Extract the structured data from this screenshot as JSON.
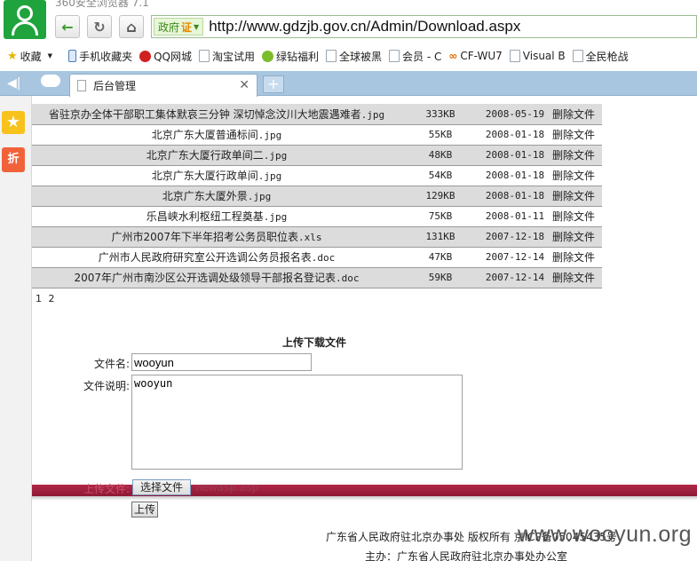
{
  "browser": {
    "title_text": "360安全浏览器 7.1",
    "gov_badge": "政府",
    "cert_badge": "证",
    "url": "http://www.gdzjb.gov.cn/Admin/Download.aspx",
    "tab_label": "后台管理",
    "bookmarks": [
      "收藏",
      "手机收藏夹",
      "QQ网城",
      "淘宝试用",
      "绿钻福利",
      "全球被黑",
      "会员 - C",
      "CF-WU7",
      "Visual B",
      "全民枪战"
    ]
  },
  "files": [
    {
      "name": "省驻京办全体干部职工集体默哀三分钟 深切悼念汶川大地震遇难者",
      "ext": ".jpg",
      "size": "333KB",
      "date": "2008-05-19",
      "action": "删除文件"
    },
    {
      "name": "北京广东大厦普通标间",
      "ext": ".jpg",
      "size": "55KB",
      "date": "2008-01-18",
      "action": "删除文件"
    },
    {
      "name": "北京广东大厦行政单间二",
      "ext": ".jpg",
      "size": "48KB",
      "date": "2008-01-18",
      "action": "删除文件"
    },
    {
      "name": "北京广东大厦行政单间",
      "ext": ".jpg",
      "size": "54KB",
      "date": "2008-01-18",
      "action": "删除文件"
    },
    {
      "name": "北京广东大厦外景",
      "ext": ".jpg",
      "size": "129KB",
      "date": "2008-01-18",
      "action": "删除文件"
    },
    {
      "name": "乐昌峡水利枢纽工程奠基",
      "ext": ".jpg",
      "size": "75KB",
      "date": "2008-01-11",
      "action": "删除文件"
    },
    {
      "name": "广州市2007年下半年招考公务员职位表",
      "ext": ".xls",
      "size": "131KB",
      "date": "2007-12-18",
      "action": "删除文件"
    },
    {
      "name": "广州市人民政府研究室公开选调公务员报名表",
      "ext": ".doc",
      "size": "47KB",
      "date": "2007-12-14",
      "action": "删除文件"
    },
    {
      "name": "2007年广州市南沙区公开选调处级领导干部报名登记表",
      "ext": ".doc",
      "size": "59KB",
      "date": "2007-12-14",
      "action": "删除文件"
    }
  ],
  "pager": "1 2",
  "upload": {
    "title": "上传下载文件",
    "name_label": "文件名:",
    "name_value": "wooyun",
    "desc_label": "文件说明:",
    "desc_value": "wooyun",
    "file_label": "上传文件:",
    "choose_button": "选择文件",
    "file_name": "newasp.asp",
    "submit": "上传"
  },
  "footer": {
    "line1": "广东省人民政府驻北京办事处 版权所有 京ICP备05045435号",
    "line2": "主办：广东省人民政府驻北京办事处办公室"
  },
  "watermark": "www.wooyun.org",
  "colors": {
    "row_alt": "#dcdcdc",
    "banner": "#a32040",
    "tabbar": "#a9c6e0",
    "logo": "#1fa33d"
  }
}
